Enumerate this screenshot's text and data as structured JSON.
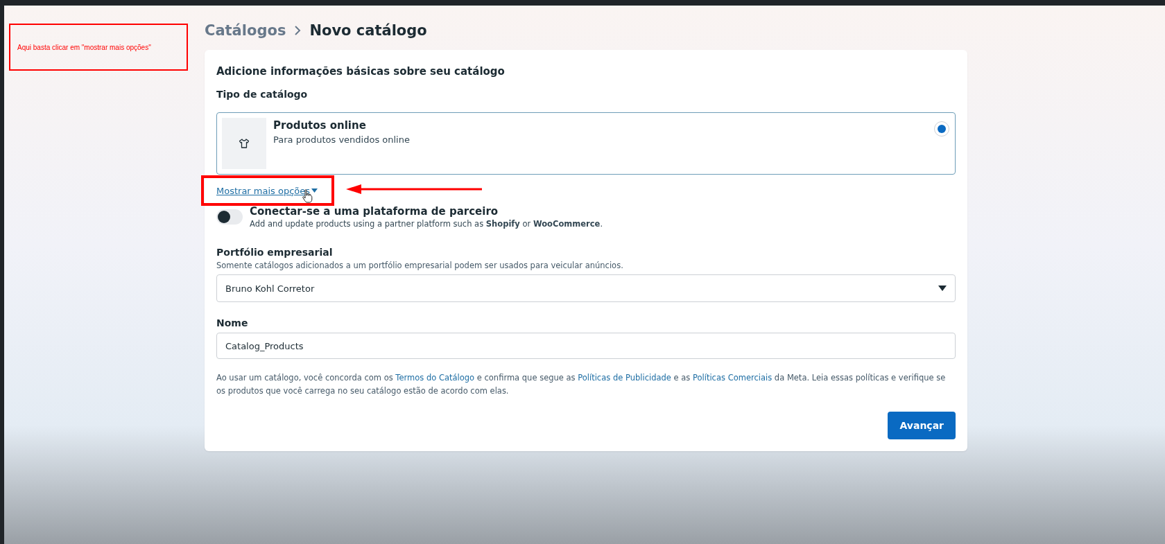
{
  "annotation": {
    "note": "Aqui basta clicar em \"mostrar mais opções\""
  },
  "breadcrumb": [
    {
      "label": "Catálogos",
      "current": false
    },
    {
      "label": "Novo catálogo",
      "current": true
    }
  ],
  "card": {
    "title": "Adicione informações básicas sobre seu catálogo",
    "catalog_type": {
      "label": "Tipo de catálogo",
      "options": [
        {
          "title": "Produtos online",
          "description": "Para produtos vendidos online",
          "selected": true
        }
      ]
    },
    "more_options": {
      "label": "Mostrar mais opções",
      "highlighted": true
    },
    "partner": {
      "title": "Conectar-se a uma plataforma de parceiro",
      "description": "Add and update products using a partner platform such as **Shopify** or **WooCommerce**.",
      "on": false
    },
    "portfolio": {
      "label": "Portfólio empresarial",
      "hint": "Somente catálogos adicionados a um portfólio empresarial podem ser usados para veicular anúncios.",
      "value": "Bruno Kohl Corretor"
    },
    "name": {
      "label": "Nome",
      "value": "Catalog_Products"
    },
    "terms": [
      {
        "kind": "text",
        "text": "Ao usar um catálogo, você concorda com os "
      },
      {
        "kind": "link",
        "text": "Termos do Catálogo"
      },
      {
        "kind": "text",
        "text": " e confirma que segue as "
      },
      {
        "kind": "link",
        "text": "Políticas de Publicidade"
      },
      {
        "kind": "text",
        "text": " e as "
      },
      {
        "kind": "link",
        "text": "Políticas Comerciais"
      },
      {
        "kind": "text",
        "text": " da Meta. Leia essas políticas e verifique se os produtos que você carrega no seu catálogo estão de acordo com elas."
      }
    ],
    "next_button": "Avançar"
  }
}
